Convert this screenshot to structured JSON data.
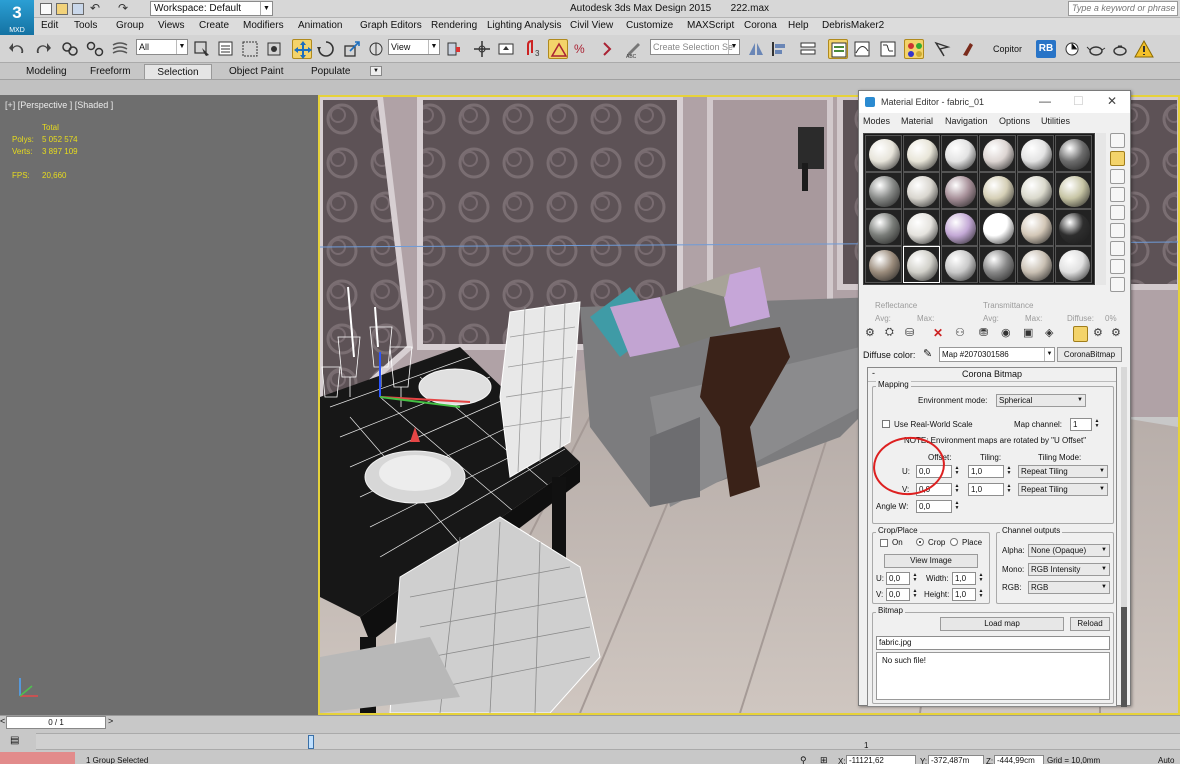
{
  "app": {
    "logo": "3",
    "logo_sub": "MXD",
    "title": "Autodesk 3ds Max Design 2015",
    "file": "222.max",
    "workspace": "Workspace: Default",
    "search_placeholder": "Type a keyword or phrase"
  },
  "menu": [
    "Edit",
    "Tools",
    "Group",
    "Views",
    "Create",
    "Modifiers",
    "Animation",
    "Graph Editors",
    "Rendering",
    "Lighting Analysis",
    "Civil View",
    "Customize",
    "MAXScript",
    "Corona",
    "Help",
    "DebrisMaker2"
  ],
  "toolbar": {
    "filter": "All",
    "ref_coord": "View",
    "selection_set": "Create Selection Se",
    "copitor": "Copitor",
    "rb": "RB"
  },
  "ribbon": {
    "tabs": [
      "Modeling",
      "Freeform",
      "Selection",
      "Object Paint",
      "Populate"
    ],
    "active": "Selection"
  },
  "viewport": {
    "label": "[+] [Perspective ] [Shaded ]",
    "stats": {
      "total_label": "Total",
      "polys_label": "Polys:",
      "polys": "5 052 574",
      "verts_label": "Verts:",
      "verts": "3 897 109",
      "fps_label": "FPS:",
      "fps": "20,660"
    }
  },
  "material_editor": {
    "title": "Material Editor - fabric_01",
    "menu": [
      "Modes",
      "Material",
      "Navigation",
      "Options",
      "Utilities"
    ],
    "spheres": [
      [
        "#e7e4da",
        "#e8e5d8",
        "#e3e3e3",
        "#ddd5d2",
        "#e3e3e3",
        "#6d6d6d"
      ],
      [
        "#888a88",
        "#d9d6cf",
        "#a8919a",
        "#d5cfb6",
        "#dad9cc",
        "#c7c5a5"
      ],
      [
        "#7a7d79",
        "#e5e3de",
        "#c4a9d6",
        "#ffffff",
        "#d3c7b7",
        "#2e2e2e"
      ],
      [
        "#9b8c7c",
        "#d1d0c9",
        "#c9c9c9",
        "#888888",
        "#c9c0b3",
        "#e0e0e0"
      ]
    ],
    "reflectance": "Reflectance",
    "transmittance": "Transmittance",
    "avg": "Avg:",
    "max": "Max:",
    "diffuse": "Diffuse:",
    "diffuse_val": "0%",
    "diffuse_color": "Diffuse color:",
    "map_name": "Map #2070301586",
    "map_type": "CoronaBitmap",
    "rollout_title": "Corona Bitmap",
    "mapping": {
      "label": "Mapping",
      "env_mode_label": "Environment mode:",
      "env_mode": "Spherical",
      "real_world": "Use Real-World Scale",
      "map_channel_label": "Map channel:",
      "map_channel": "1",
      "note": "NOTE: Environment maps are rotated by \"U Offset\"",
      "offset": "Offset:",
      "tiling": "Tiling:",
      "tiling_mode": "Tiling Mode:",
      "u": "U:",
      "v": "V:",
      "u_offset": "0,0",
      "v_offset": "0,0",
      "u_tiling": "1,0",
      "v_tiling": "1,0",
      "u_mode": "Repeat Tiling",
      "v_mode": "Repeat Tiling",
      "angle_w_label": "Angle W:",
      "angle_w": "0,0"
    },
    "crop": {
      "label": "Crop/Place",
      "on": "On",
      "crop": "Crop",
      "place": "Place",
      "view_image": "View Image",
      "u_label": "U:",
      "v_label": "V:",
      "u": "0,0",
      "v": "0,0",
      "width_label": "Width:",
      "height_label": "Height:",
      "width": "1,0",
      "height": "1,0"
    },
    "channels": {
      "label": "Channel outputs",
      "alpha_label": "Alpha:",
      "alpha": "None (Opaque)",
      "mono_label": "Mono:",
      "mono": "RGB Intensity",
      "rgb_label": "RGB:",
      "rgb": "RGB"
    },
    "bitmap": {
      "label": "Bitmap",
      "load": "Load map",
      "reload": "Reload",
      "file": "fabric.jpg",
      "error": "No such file!"
    }
  },
  "bottom": {
    "frame": "0 / 1",
    "tick": "1",
    "status": "1 Group Selected",
    "x_label": "X:",
    "x": "-11121,62",
    "y_label": "Y:",
    "y": "-372,487m",
    "z_label": "Z:",
    "z": "-444,99cm",
    "grid": "Grid = 10,0mm",
    "auto": "Auto"
  }
}
